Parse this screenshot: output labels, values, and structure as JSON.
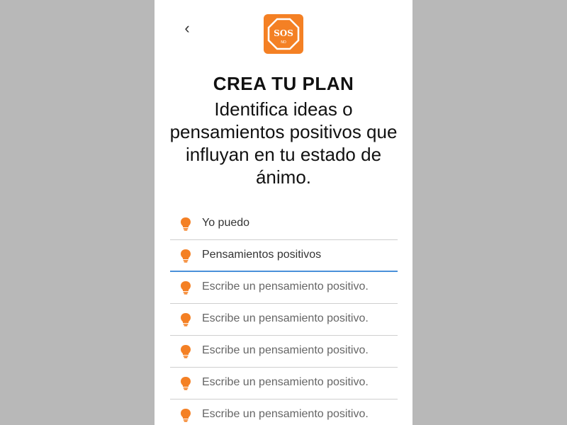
{
  "header": {
    "back_icon": "chevron-left-icon",
    "logo": {
      "text_main": "SOS",
      "text_sub": "ND",
      "color": "#f48024"
    }
  },
  "title": "CREA TU PLAN",
  "subtitle": "Identifica ideas o pensamientos positivos que influyan en tu estado de ánimo.",
  "accent_color": "#f48024",
  "focus_color": "#4a90d9",
  "thoughts": [
    {
      "value": "Yo puedo",
      "placeholder": "Escribe un pensamiento positivo."
    },
    {
      "value": "Pensamientos positivos",
      "placeholder": "Escribe un pensamiento positivo."
    },
    {
      "value": "",
      "placeholder": "Escribe un pensamiento positivo."
    },
    {
      "value": "",
      "placeholder": "Escribe un pensamiento positivo."
    },
    {
      "value": "",
      "placeholder": "Escribe un pensamiento positivo."
    },
    {
      "value": "",
      "placeholder": "Escribe un pensamiento positivo."
    },
    {
      "value": "",
      "placeholder": "Escribe un pensamiento positivo."
    }
  ]
}
